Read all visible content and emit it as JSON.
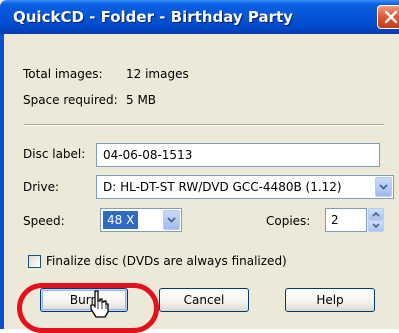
{
  "window": {
    "title": "QuickCD - Folder - Birthday Party"
  },
  "summary": {
    "total_images_label": "Total images:",
    "total_images_value": "12 images",
    "space_required_label": "Space required:",
    "space_required_value": "5 MB"
  },
  "form": {
    "disc_label_label": "Disc label:",
    "disc_label_value": "04-06-08-1513",
    "drive_label": "Drive:",
    "drive_value": "D: HL-DT-ST RW/DVD GCC-4480B (1.12)",
    "speed_label": "Speed:",
    "speed_value": "48 X",
    "copies_label": "Copies:",
    "copies_value": "2",
    "finalize_label": "Finalize disc (DVDs are always finalized)",
    "finalize_checked": false
  },
  "buttons": {
    "burn": "Burn",
    "cancel": "Cancel",
    "help": "Help"
  },
  "annotation": {
    "highlight_color": "#e3111c",
    "highlight_target": "burn-button"
  },
  "icons": [
    "close-icon",
    "chevron-down-icon",
    "spin-up-icon",
    "spin-down-icon",
    "cursor-pointer-icon"
  ]
}
